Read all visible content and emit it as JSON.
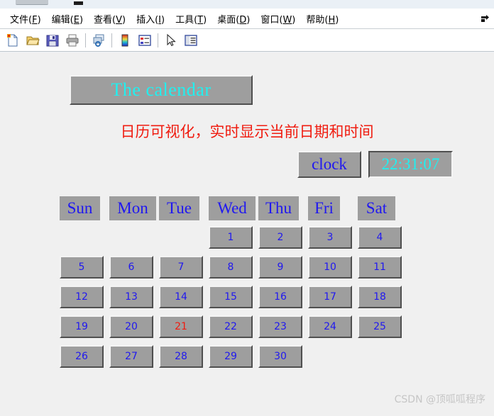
{
  "window": {
    "titlebar_visible": true
  },
  "menubar": {
    "items": [
      {
        "label": "文件(",
        "accel": "F",
        "close": ")",
        "name": "file"
      },
      {
        "label": "编辑(",
        "accel": "E",
        "close": ")",
        "name": "edit"
      },
      {
        "label": "查看(",
        "accel": "V",
        "close": ")",
        "name": "view"
      },
      {
        "label": "插入(",
        "accel": "I",
        "close": ")",
        "name": "insert"
      },
      {
        "label": "工具(",
        "accel": "T",
        "close": ")",
        "name": "tools"
      },
      {
        "label": "桌面(",
        "accel": "D",
        "close": ")",
        "name": "desktop"
      },
      {
        "label": "窗口(",
        "accel": "W",
        "close": ")",
        "name": "window"
      },
      {
        "label": "帮助(",
        "accel": "H",
        "close": ")",
        "name": "help"
      }
    ],
    "dock_icon": "dock-arrow-icon"
  },
  "toolbar": {
    "buttons": [
      {
        "name": "new-figure-icon"
      },
      {
        "name": "open-file-icon"
      },
      {
        "name": "save-figure-icon"
      },
      {
        "name": "print-figure-icon"
      },
      {
        "sep": true
      },
      {
        "name": "link-plot-icon"
      },
      {
        "sep": true
      },
      {
        "name": "colorbar-icon"
      },
      {
        "name": "legend-icon"
      },
      {
        "sep": true
      },
      {
        "name": "pointer-select-icon"
      },
      {
        "name": "plot-browser-icon"
      }
    ]
  },
  "figure": {
    "title": "The calendar",
    "subtitle": "日历可视化，实时显示当前日期和时间",
    "clock_label": "clock",
    "clock_value": "22:31:07",
    "weekdays": [
      "Sun",
      "Mon",
      "Tue",
      "Wed",
      "Thu",
      "Fri",
      "Sat"
    ],
    "days": [
      {
        "label": "",
        "empty": true
      },
      {
        "label": "",
        "empty": true
      },
      {
        "label": "",
        "empty": true
      },
      {
        "label": "1",
        "empty": false
      },
      {
        "label": "2",
        "empty": false
      },
      {
        "label": "3",
        "empty": false
      },
      {
        "label": "4",
        "empty": false
      },
      {
        "label": "5",
        "empty": false
      },
      {
        "label": "6",
        "empty": false
      },
      {
        "label": "7",
        "empty": false
      },
      {
        "label": "8",
        "empty": false
      },
      {
        "label": "9",
        "empty": false
      },
      {
        "label": "10",
        "empty": false
      },
      {
        "label": "11",
        "empty": false
      },
      {
        "label": "12",
        "empty": false
      },
      {
        "label": "13",
        "empty": false
      },
      {
        "label": "14",
        "empty": false
      },
      {
        "label": "15",
        "empty": false
      },
      {
        "label": "16",
        "empty": false
      },
      {
        "label": "17",
        "empty": false
      },
      {
        "label": "18",
        "empty": false
      },
      {
        "label": "19",
        "empty": false
      },
      {
        "label": "20",
        "empty": false
      },
      {
        "label": "21",
        "empty": false,
        "today": true
      },
      {
        "label": "22",
        "empty": false
      },
      {
        "label": "23",
        "empty": false
      },
      {
        "label": "24",
        "empty": false
      },
      {
        "label": "25",
        "empty": false
      },
      {
        "label": "26",
        "empty": false
      },
      {
        "label": "27",
        "empty": false
      },
      {
        "label": "28",
        "empty": false
      },
      {
        "label": "29",
        "empty": false
      },
      {
        "label": "30",
        "empty": false
      },
      {
        "label": "",
        "empty": true
      },
      {
        "label": "",
        "empty": true
      }
    ],
    "today": "21"
  },
  "watermark": "CSDN @顶呱呱程序",
  "colors": {
    "figure_bg": "#f0f0f0",
    "widget_face": "#9e9e9e",
    "title_text": "#20f0f0",
    "subtitle_text": "#f01c10",
    "weekday_text": "#2018f0",
    "day_text": "#2018f0",
    "today_text": "#f01c10",
    "clock_label_text": "#2018f0",
    "clock_value_text": "#20f0f0"
  }
}
